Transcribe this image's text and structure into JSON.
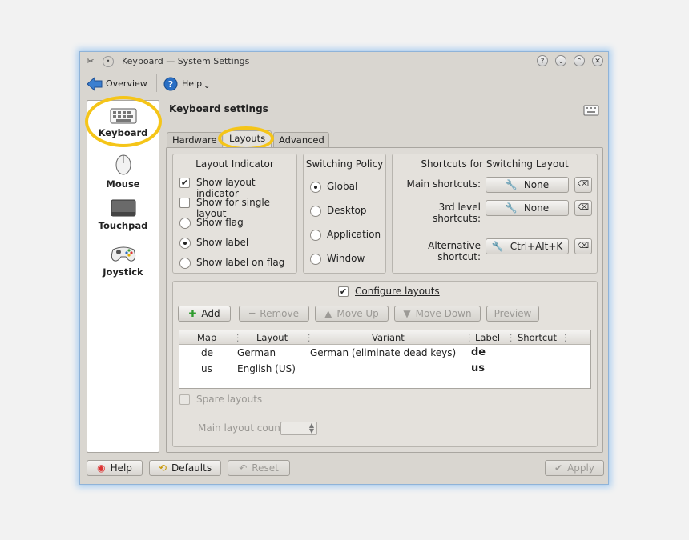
{
  "window": {
    "title": "Keyboard — System Settings"
  },
  "toolbar": {
    "overview_label": "Overview",
    "help_label": "Help"
  },
  "sidebar": {
    "items": [
      {
        "label": "Keyboard",
        "icon": "keyboard-icon"
      },
      {
        "label": "Mouse",
        "icon": "mouse-icon"
      },
      {
        "label": "Touchpad",
        "icon": "touchpad-icon"
      },
      {
        "label": "Joystick",
        "icon": "joystick-icon"
      }
    ],
    "selected": "Keyboard"
  },
  "page": {
    "title": "Keyboard settings"
  },
  "tabs": [
    {
      "label": "Hardware"
    },
    {
      "label": "Layouts"
    },
    {
      "label": "Advanced"
    }
  ],
  "layout_indicator": {
    "title": "Layout Indicator",
    "options": [
      {
        "label": "Show layout indicator",
        "checked": true
      },
      {
        "label": "Show for single layout",
        "checked": false
      }
    ],
    "radios": [
      {
        "label": "Show flag",
        "selected": false
      },
      {
        "label": "Show label",
        "selected": true
      },
      {
        "label": "Show label on flag",
        "selected": false
      }
    ]
  },
  "switching_policy": {
    "title": "Switching Policy",
    "options": [
      {
        "label": "Global",
        "selected": true
      },
      {
        "label": "Desktop",
        "selected": false
      },
      {
        "label": "Application",
        "selected": false
      },
      {
        "label": "Window",
        "selected": false
      }
    ]
  },
  "shortcuts": {
    "title": "Shortcuts for Switching Layout",
    "rows": [
      {
        "label": "Main shortcuts:",
        "value": "None"
      },
      {
        "label": "3rd level shortcuts:",
        "value": "None"
      },
      {
        "label": "Alternative shortcut:",
        "value": "Ctrl+Alt+K"
      }
    ]
  },
  "configure": {
    "checkbox_label": "Configure layouts",
    "checked": true,
    "buttons": {
      "add": "Add",
      "remove": "Remove",
      "move_up": "Move Up",
      "move_down": "Move Down",
      "preview": "Preview"
    },
    "table": {
      "headers": [
        "Map",
        "Layout",
        "Variant",
        "Label",
        "Shortcut"
      ],
      "rows": [
        {
          "map": "de",
          "layout": "German",
          "variant": "German (eliminate dead keys)",
          "label": "de",
          "shortcut": ""
        },
        {
          "map": "us",
          "layout": "English (US)",
          "variant": "",
          "label": "us",
          "shortcut": ""
        }
      ]
    },
    "spare_layouts_label": "Spare layouts",
    "main_layout_count_label": "Main layout count:"
  },
  "bottom": {
    "help": "Help",
    "defaults": "Defaults",
    "reset": "Reset",
    "apply": "Apply"
  },
  "colors": {
    "highlight": "#f5c518",
    "window_glow": "#a9cdf0"
  }
}
